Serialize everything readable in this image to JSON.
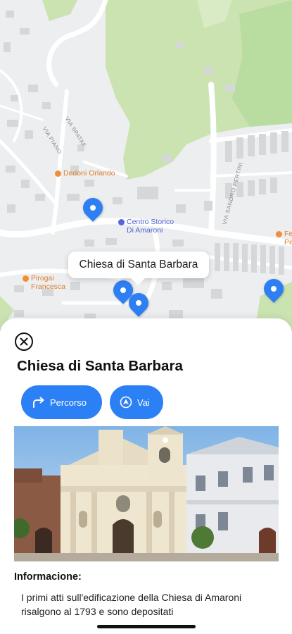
{
  "map": {
    "pois": [
      {
        "label": "Dedoni Orlando",
        "color": "orange"
      },
      {
        "label": "Centro Storico\nDi Amaroni",
        "color": "blue"
      },
      {
        "label": "Pirogai\nFrancesca",
        "color": "orange"
      },
      {
        "label": "Fe\nPe",
        "color": "orange"
      }
    ],
    "road_labels": [
      "VIA SPATAF",
      "VIA PIANO",
      "VIA SANDRO PERTINI"
    ],
    "callout_title": "Chiesa di Santa Barbara"
  },
  "sheet": {
    "title": "Chiesa di Santa Barbara",
    "route_label": "Percorso",
    "go_label": "Vai",
    "info_heading": "Informacione:",
    "info_text": "I primi atti sull'edificazione della Chiesa di Amaroni risalgono al 1793 e sono depositati"
  },
  "colors": {
    "accent": "#2c80f5",
    "park": "#cbe3b1"
  },
  "icons": [
    "close-icon",
    "route-arrow-icon",
    "navigate-icon",
    "map-pin-icon"
  ]
}
